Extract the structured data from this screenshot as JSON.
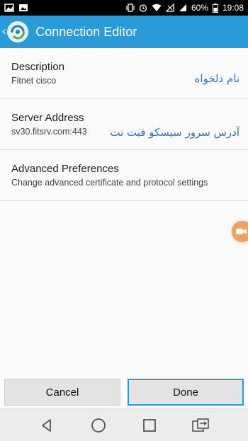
{
  "status_bar": {
    "battery": "60%",
    "time": "19:08",
    "icons_left": [
      "image-icon",
      "gallery-icon"
    ],
    "icons_right": [
      "vibrate-icon",
      "alarm-icon",
      "wifi-icon",
      "no-signal-icon",
      "signal-icon",
      "battery-icon"
    ]
  },
  "app_bar": {
    "title": "Connection Editor",
    "icons": [
      "back-chevron-icon",
      "app-logo-icon"
    ],
    "color": "#2a9ad8"
  },
  "preferences": [
    {
      "title": "Description",
      "summary": "Fitnet cisco",
      "annotation": "نام دلخواه"
    },
    {
      "title": "Server Address",
      "summary": "sv30.fitsrv.com:443",
      "annotation": "آدرس سرور سیسکو فیت نت"
    },
    {
      "title": "Advanced Preferences",
      "summary": "Change advanced certificate and protocol settings"
    }
  ],
  "floating_button": {
    "icon": "video-camera-icon",
    "color": "#f2a15c"
  },
  "buttons": {
    "cancel": "Cancel",
    "done": "Done"
  },
  "nav_bar": {
    "icons": [
      "back-triangle-icon",
      "home-circle-icon",
      "recents-square-icon",
      "switch-app-icon"
    ]
  }
}
